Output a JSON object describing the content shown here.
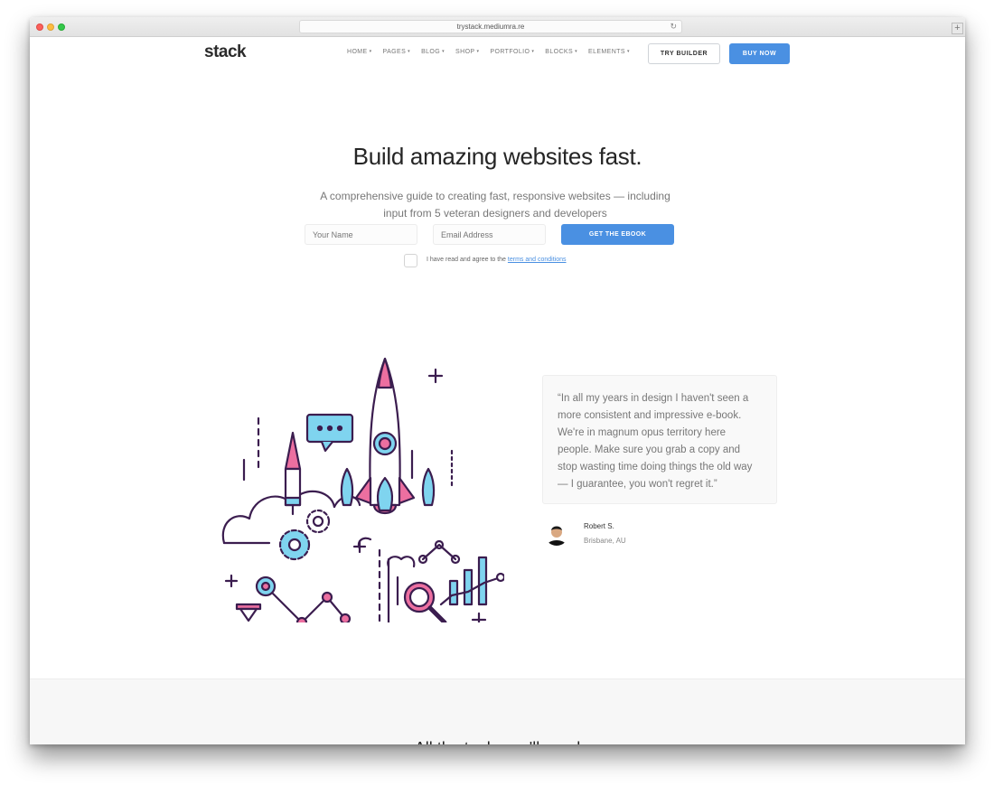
{
  "browser": {
    "url": "trystack.mediumra.re"
  },
  "header": {
    "logo": "stack",
    "nav": [
      {
        "label": "HOME"
      },
      {
        "label": "PAGES"
      },
      {
        "label": "BLOG"
      },
      {
        "label": "SHOP"
      },
      {
        "label": "PORTFOLIO"
      },
      {
        "label": "BLOCKS"
      },
      {
        "label": "ELEMENTS"
      }
    ],
    "try_builder_label": "TRY BUILDER",
    "buy_now_label": "BUY NOW"
  },
  "hero": {
    "title": "Build amazing websites fast.",
    "subtitle": "A comprehensive guide to creating fast, responsive websites — including input from 5 veteran designers and developers",
    "name_placeholder": "Your Name",
    "email_placeholder": "Email Address",
    "cta_label": "GET THE EBOOK",
    "agree_text": "I have read and agree to the",
    "agree_link": "terms and conditions"
  },
  "testimonial": {
    "quote": "“In all my years in design I haven't seen a more consistent and impressive e-book. We're in magnum opus territory here people. Make sure you grab a copy and stop wasting time doing things the old way — I guarantee, you won't regret it.”",
    "author": "Robert S.",
    "location": "Brisbane, AU"
  },
  "next_section": {
    "title": "All the tools you'll need"
  },
  "colors": {
    "accent": "#4a90e2",
    "illustration_stroke": "#3b1d4f",
    "illustration_pink": "#ec6fa0",
    "illustration_cyan": "#7fd4ef"
  }
}
